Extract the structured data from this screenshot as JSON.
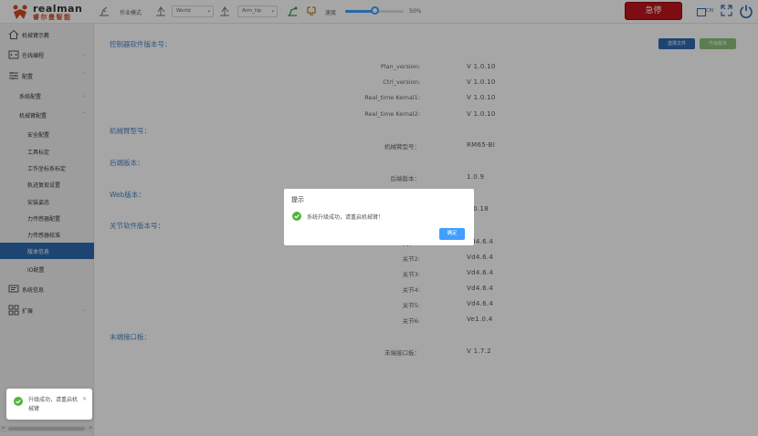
{
  "brand": {
    "name_en": "realman",
    "name_cn": "睿尔曼智能"
  },
  "toolbar": {
    "coordinate_label": "作业模式",
    "frame_select": "World",
    "tool_select": "Arm_tip",
    "speed_label": "速度",
    "speed_value": "50%",
    "speed_fraction": 0.5,
    "estop_label": "急停",
    "lang_label": "CN"
  },
  "sidebar": {
    "items": [
      {
        "label": "机械臂示教",
        "icon": "home-icon"
      },
      {
        "label": "在线编程",
        "icon": "code-icon"
      },
      {
        "label": "配置",
        "icon": "settings-icon"
      },
      {
        "label": "系统配置"
      },
      {
        "label": "机械臂配置"
      },
      {
        "label": "安全配置"
      },
      {
        "label": "工具标定"
      },
      {
        "label": "工作坐标系标定"
      },
      {
        "label": "轨迹复现设置"
      },
      {
        "label": "安装姿态"
      },
      {
        "label": "力传感器配置"
      },
      {
        "label": "力传感器校准"
      },
      {
        "label": "版本信息"
      },
      {
        "label": "IO配置"
      },
      {
        "label": "系统信息",
        "icon": "monitor-icon"
      },
      {
        "label": "扩展",
        "icon": "grid-icon"
      }
    ]
  },
  "toast": {
    "message": "升级成功，请重启机械臂"
  },
  "main": {
    "controller_title": "控制器软件版本号：",
    "select_file_label": "选择文件",
    "upgrade_label": "升级版本",
    "controller_rows": [
      {
        "key": "Plan_version:",
        "value": "V 1.0.10"
      },
      {
        "key": "Ctrl_version:",
        "value": "V 1.0.10"
      },
      {
        "key": "Real_time Kernal1:",
        "value": "V 1.0.10"
      },
      {
        "key": "Real_time Kernal2:",
        "value": "V 1.0.10"
      }
    ],
    "arm_model_title": "机械臂型号：",
    "arm_model_key": "机械臂型号：",
    "arm_model_value": "RM65-BI",
    "backend_title": "后端版本：",
    "backend_key": "后端版本：",
    "backend_value": "1.0.9",
    "web_title": "Web版本：",
    "web_value": "1.0.18",
    "joint_title": "关节软件版本号：",
    "joint_rows": [
      {
        "key": "关节1:",
        "value": "Vd4.6.4"
      },
      {
        "key": "关节2:",
        "value": "Vd4.6.4"
      },
      {
        "key": "关节3:",
        "value": "Vd4.6.4"
      },
      {
        "key": "关节4:",
        "value": "Vd4.6.4"
      },
      {
        "key": "关节5:",
        "value": "Vd4.6.4"
      },
      {
        "key": "关节6:",
        "value": "Ve1.0.4"
      }
    ],
    "end_title": "末端接口板：",
    "end_key": "末端接口板：",
    "end_value": "V 1.7.2"
  },
  "modal": {
    "title": "提示",
    "message": "系统升级成功，请重启机械臂！",
    "confirm_label": "确定"
  }
}
